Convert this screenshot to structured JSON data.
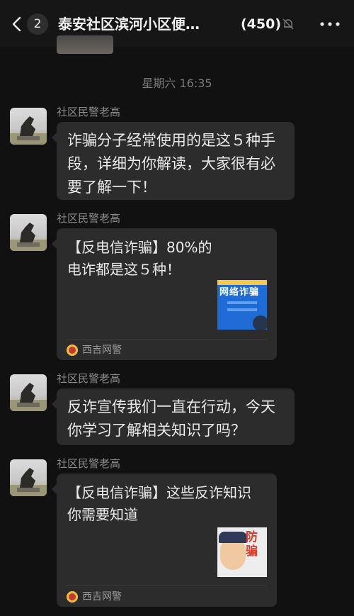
{
  "header": {
    "unread_count": "2",
    "chat_title": "泰安社区滨河小区便…",
    "member_count": "(450)"
  },
  "timestamp": "星期六 16:35",
  "messages": [
    {
      "sender": "社区民警老高",
      "type": "text",
      "text": "诈骗分子经常使用的是这５种手段，详细为你解读，大家很有必要了解一下！"
    },
    {
      "sender": "社区民警老高",
      "type": "link_card",
      "title": "【反电信诈骗】80%的电诈都是这５种！",
      "thumb_text": "网络诈骗",
      "source": "西吉网警"
    },
    {
      "sender": "社区民警老高",
      "type": "text",
      "text": "反诈宣传我们一直在行动，今天你学习了解相关知识了吗？"
    },
    {
      "sender": "社区民警老高",
      "type": "link_card",
      "title": "【反电信诈骗】这些反诈知识你需要知道",
      "thumb_text": "防骗",
      "source": "西吉网警"
    }
  ],
  "colors": {
    "background": "#111111",
    "bubble": "#2c2c2c",
    "source_icon": "#c8372d"
  }
}
